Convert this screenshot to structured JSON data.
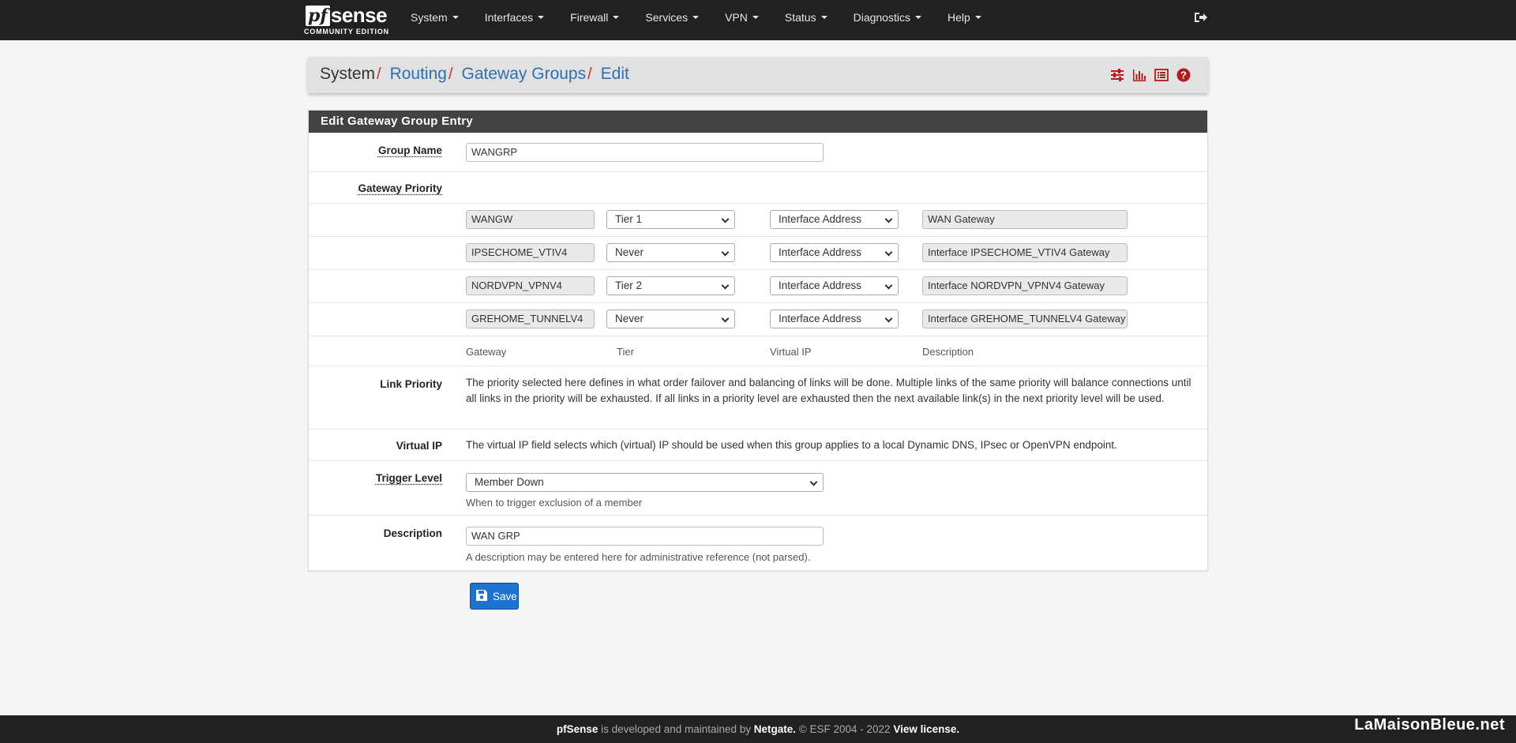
{
  "brand": {
    "logo_pf": "pf",
    "logo_sense": "sense",
    "subtitle": "COMMUNITY EDITION"
  },
  "nav": {
    "items": [
      "System",
      "Interfaces",
      "Firewall",
      "Services",
      "VPN",
      "Status",
      "Diagnostics",
      "Help"
    ]
  },
  "breadcrumb": {
    "root": "System",
    "routing": "Routing",
    "gateway_groups": "Gateway Groups",
    "edit": "Edit",
    "sep": "/"
  },
  "panel": {
    "title": "Edit Gateway Group Entry",
    "group_name_label": "Group Name",
    "group_name_value": "WANGRP",
    "gateway_priority_label": "Gateway Priority",
    "gateways": [
      {
        "gateway": "WANGW",
        "tier": "Tier 1",
        "vip": "Interface Address",
        "description": "WAN Gateway"
      },
      {
        "gateway": "IPSECHOME_VTIV4",
        "tier": "Never",
        "vip": "Interface Address",
        "description": "Interface IPSECHOME_VTIV4 Gateway"
      },
      {
        "gateway": "NORDVPN_VPNV4",
        "tier": "Tier 2",
        "vip": "Interface Address",
        "description": "Interface NORDVPN_VPNV4 Gateway"
      },
      {
        "gateway": "GREHOME_TUNNELV4",
        "tier": "Never",
        "vip": "Interface Address",
        "description": "Interface GREHOME_TUNNELV4 Gateway"
      }
    ],
    "columns": {
      "gateway": "Gateway",
      "tier": "Tier",
      "vip": "Virtual IP",
      "description": "Description"
    },
    "link_priority_label": "Link Priority",
    "link_priority_text": "The priority selected here defines in what order failover and balancing of links will be done. Multiple links of the same priority will balance connections until all links in the priority will be exhausted. If all links in a priority level are exhausted then the next available link(s) in the next priority level will be used.",
    "virtual_ip_label": "Virtual IP",
    "virtual_ip_text": "The virtual IP field selects which (virtual) IP should be used when this group applies to a local Dynamic DNS, IPsec or OpenVPN endpoint.",
    "trigger_level_label": "Trigger Level",
    "trigger_level_value": "Member Down",
    "trigger_level_help": "When to trigger exclusion of a member",
    "description_label": "Description",
    "description_value": "WAN GRP",
    "description_help": "A description may be entered here for administrative reference (not parsed)."
  },
  "save_label": "Save",
  "footer": {
    "pfsense": "pfSense",
    "text1": " is developed and maintained by ",
    "netgate": "Netgate.",
    "text2": " © ESF 2004 - 2022 ",
    "license": "View license."
  },
  "watermark": "LaMaisonBleue.net",
  "colors": {
    "accent": "#b31b1b",
    "link": "#2f6fb0",
    "save": "#1e73d0"
  }
}
